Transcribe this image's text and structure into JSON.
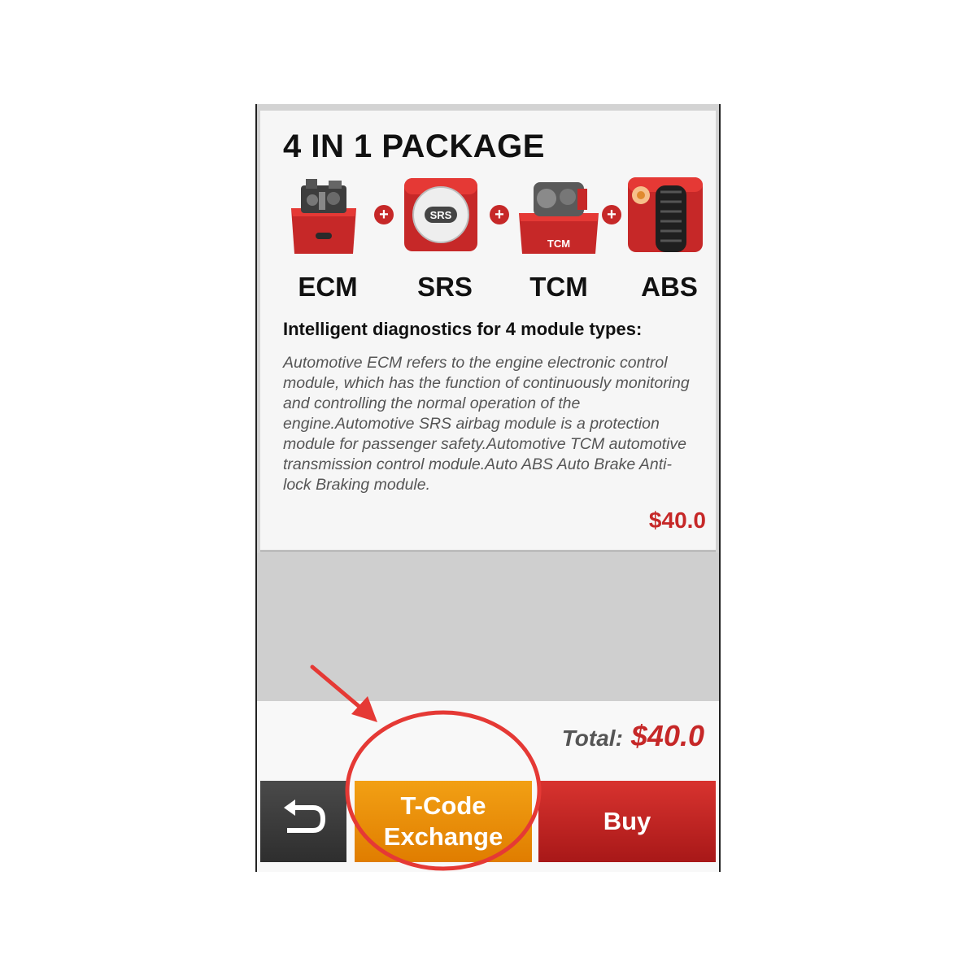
{
  "package": {
    "title": "4 IN 1 PACKAGE",
    "modules": [
      {
        "label": "ECM",
        "icon": "engine-icon"
      },
      {
        "label": "SRS",
        "icon": "airbag-icon",
        "badge": "SRS"
      },
      {
        "label": "TCM",
        "icon": "transmission-icon",
        "badge": "TCM"
      },
      {
        "label": "ABS",
        "icon": "tire-icon"
      }
    ],
    "plus_symbol": "+",
    "subtitle": "Intelligent diagnostics for 4 module types:",
    "description": "Automotive ECM refers to the engine electronic control module, which has the function of continuously monitoring and controlling the normal operation of the engine.Automotive SRS airbag module is a protection module for passenger safety.Automotive TCM automotive transmission control module.Auto ABS Auto Brake Anti-lock Braking module.",
    "price": "$40.0"
  },
  "footer": {
    "total_label": "Total:",
    "total_amount": "$40.0",
    "back_icon": "back-arrow-icon",
    "tcode_line1": "T-Code",
    "tcode_line2": "Exchange",
    "buy_label": "Buy"
  },
  "colors": {
    "accent_red": "#c62828",
    "tcode_orange": "#e88a00",
    "annotation_red": "#e53935"
  }
}
